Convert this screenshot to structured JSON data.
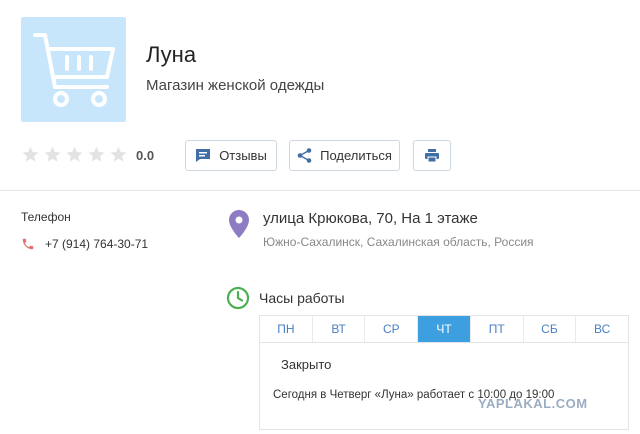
{
  "shop": {
    "name": "Луна",
    "description": "Магазин женской одежды",
    "logo_icon": "shopping-cart-icon"
  },
  "rating": {
    "value": "0.0",
    "stars_filled": 0,
    "stars_total": 5
  },
  "actions": {
    "reviews_label": "Отзывы",
    "share_label": "Поделиться",
    "print_icon": "print-icon"
  },
  "contact": {
    "phone_label": "Телефон",
    "phone": "+7 (914) 764-30-71"
  },
  "address": {
    "street": "улица Крюкова, 70, На 1 этаже",
    "city": "Южно-Сахалинск, Сахалинская область, Россия"
  },
  "hours": {
    "label": "Часы работы",
    "days": [
      "ПН",
      "ВТ",
      "СР",
      "ЧТ",
      "ПТ",
      "СБ",
      "ВС"
    ],
    "active_day": "ЧТ",
    "status": "Закрыто",
    "today_text": "Сегодня в Четверг «Луна» работает с 10:00 до 19:00"
  },
  "watermark": "YAPLAKAL.COM",
  "colors": {
    "accent": "#3d9ee0",
    "logo_bg": "#c8e6fb",
    "pin": "#8e7cc3",
    "clock": "#4caf50",
    "phone": "#e57373"
  }
}
